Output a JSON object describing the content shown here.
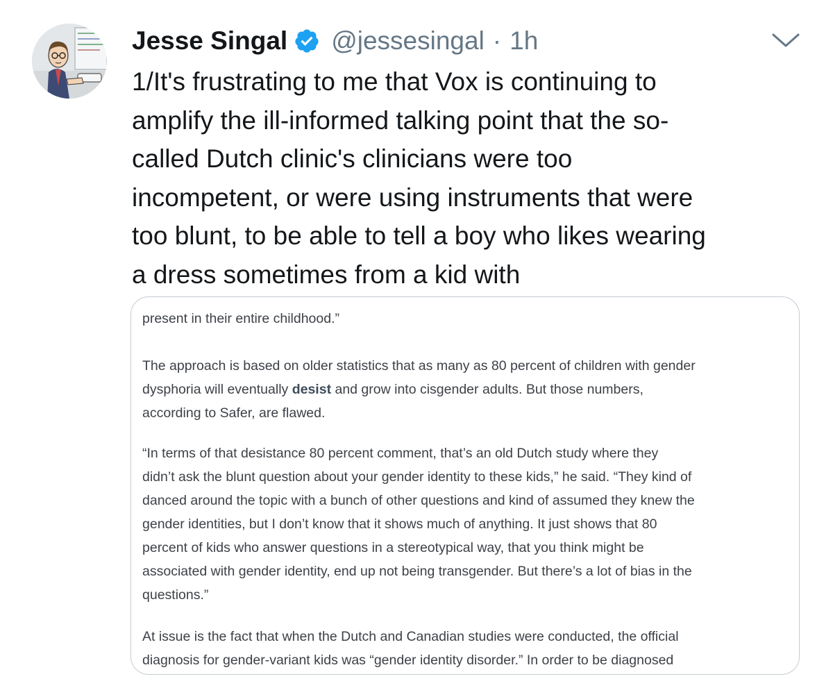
{
  "tweet": {
    "author_name": "Jesse Singal",
    "handle": "@jessesingal",
    "separator": "·",
    "timestamp": "1h",
    "verified": true,
    "text_lines": [
      "1/It's frustrating to me that Vox is continuing to",
      "amplify the ill-informed talking point that the so-",
      "called Dutch clinic's clinicians were too",
      "incompetent, or were using instruments that were",
      "too blunt, to be able to tell a boy who likes wearing",
      "a dress sometimes from a kid with"
    ]
  },
  "screenshot_card": {
    "para0": [
      "present in their entire childhood.”"
    ],
    "para1": {
      "line1": "The approach is based on older statistics that as many as 80 percent of children with gender",
      "line2_before": "dysphoria will eventually ",
      "line2_link": "desist",
      "line2_after": " and grow into cisgender adults. But those numbers,",
      "line3": "according to Safer, are flawed."
    },
    "para2": [
      "“In terms of that desistance 80 percent comment, that’s an old Dutch study where they",
      "didn’t ask the blunt question about your gender identity to these kids,” he said. “They kind of",
      "danced around the topic with a bunch of other questions and kind of assumed they knew the",
      "gender identities, but I don’t know that it shows much of anything. It just shows that 80",
      "percent of kids who answer questions in a stereotypical way, that you think might be",
      "associated with gender identity, end up not being transgender. But there’s a lot of bias in the",
      "questions.”"
    ],
    "para3": [
      "At issue is the fact that when the Dutch and Canadian studies were conducted, the official",
      "diagnosis for gender-variant kids was “gender identity disorder.” In order to be diagnosed"
    ]
  },
  "colors": {
    "verified_badge": "#1da1f2",
    "secondary_text": "#657786",
    "card_border": "#c4ccd3"
  },
  "icons": [
    "avatar-illustration",
    "verified-badge-icon",
    "chevron-down-icon"
  ]
}
